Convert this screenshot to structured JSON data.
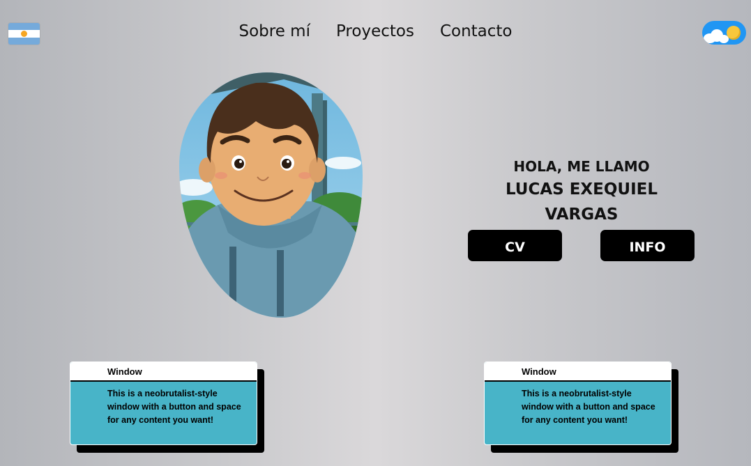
{
  "nav": {
    "items": [
      {
        "label": "Sobre mí"
      },
      {
        "label": "Proyectos"
      },
      {
        "label": "Contacto"
      }
    ]
  },
  "flag": {
    "country": "Argentina",
    "colors": [
      "#75aadb",
      "#ffffff",
      "#75aadb"
    ],
    "sun": "#f6a623"
  },
  "theme_toggle": {
    "state": "day",
    "track_color": "#2196f3",
    "knob_color": "#f9c73c"
  },
  "hero": {
    "greeting": "HOLA, ME LLAMO",
    "name_line1": "LUCAS EXEQUIEL",
    "name_line2": "VARGAS"
  },
  "buttons": {
    "cv_label": "CV",
    "info_label": "INFO"
  },
  "windows": [
    {
      "title": "Window",
      "text": "This is a neobrutalist-style window with a button and space for any content you want!"
    },
    {
      "title": "Window",
      "text": "This is a neobrutalist-style window with a button and space for any content you want!"
    }
  ],
  "colors": {
    "window_body": "#48b4c8",
    "button_bg": "#000000"
  }
}
